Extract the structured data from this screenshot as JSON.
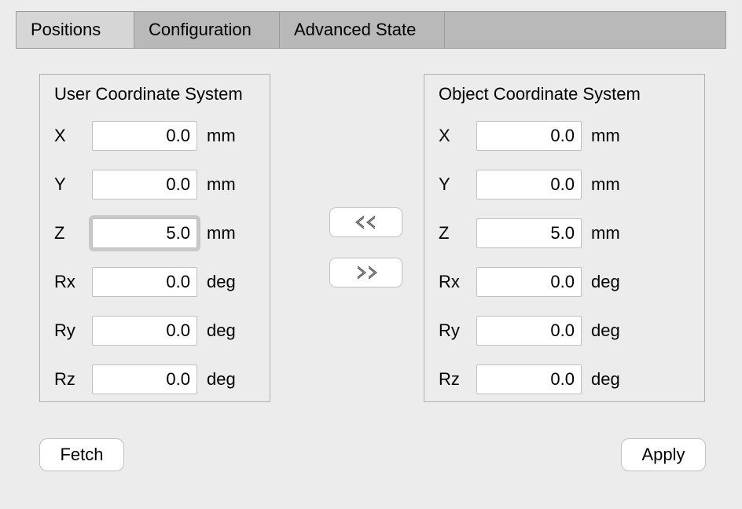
{
  "tabs": {
    "positions": "Positions",
    "configuration": "Configuration",
    "advanced": "Advanced State"
  },
  "ucs": {
    "title": "User Coordinate System",
    "x": {
      "label": "X",
      "value": "0.0",
      "unit": "mm"
    },
    "y": {
      "label": "Y",
      "value": "0.0",
      "unit": "mm"
    },
    "z": {
      "label": "Z",
      "value": "5.0",
      "unit": "mm"
    },
    "rx": {
      "label": "Rx",
      "value": "0.0",
      "unit": "deg"
    },
    "ry": {
      "label": "Ry",
      "value": "0.0",
      "unit": "deg"
    },
    "rz": {
      "label": "Rz",
      "value": "0.0",
      "unit": "deg"
    }
  },
  "ocs": {
    "title": "Object Coordinate System",
    "x": {
      "label": "X",
      "value": "0.0",
      "unit": "mm"
    },
    "y": {
      "label": "Y",
      "value": "0.0",
      "unit": "mm"
    },
    "z": {
      "label": "Z",
      "value": "5.0",
      "unit": "mm"
    },
    "rx": {
      "label": "Rx",
      "value": "0.0",
      "unit": "deg"
    },
    "ry": {
      "label": "Ry",
      "value": "0.0",
      "unit": "deg"
    },
    "rz": {
      "label": "Rz",
      "value": "0.0",
      "unit": "deg"
    }
  },
  "buttons": {
    "fetch": "Fetch",
    "apply": "Apply"
  }
}
